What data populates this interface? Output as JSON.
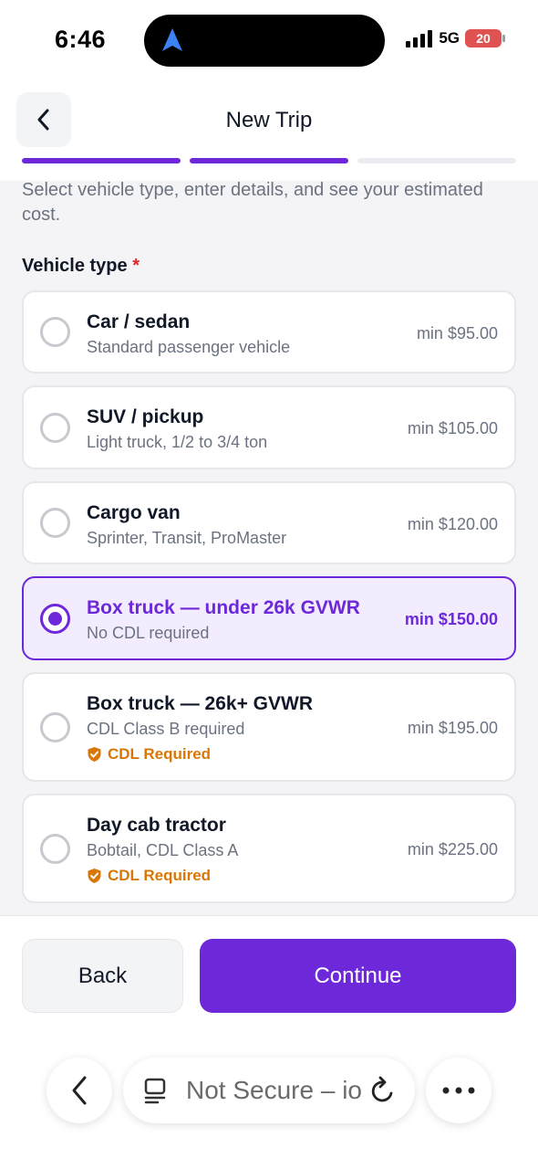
{
  "status_bar": {
    "time": "6:46",
    "network": "5G",
    "battery": "20"
  },
  "header": {
    "title": "New Trip"
  },
  "progress": {
    "steps": 3,
    "current": 2
  },
  "intro": {
    "text": "Select vehicle type, enter details, and see your estimated cost."
  },
  "vehicle_section": {
    "label": "Vehicle type",
    "required_mark": "*"
  },
  "vehicle_options": [
    {
      "title": "Car / sedan",
      "subtitle": "Standard passenger vehicle",
      "price": "min $95.00",
      "selected": false,
      "badge": ""
    },
    {
      "title": "SUV / pickup",
      "subtitle": "Light truck, 1/2 to 3/4 ton",
      "price": "min $105.00",
      "selected": false,
      "badge": ""
    },
    {
      "title": "Cargo van",
      "subtitle": "Sprinter, Transit, ProMaster",
      "price": "min $120.00",
      "selected": false,
      "badge": ""
    },
    {
      "title": "Box truck — under 26k GVWR",
      "subtitle": "No CDL required",
      "price": "min $150.00",
      "selected": true,
      "badge": ""
    },
    {
      "title": "Box truck — 26k+ GVWR",
      "subtitle": "CDL Class B required",
      "price": "min $195.00",
      "selected": false,
      "badge": "CDL Required"
    },
    {
      "title": "Day cab tractor",
      "subtitle": "Bobtail, CDL Class A",
      "price": "min $225.00",
      "selected": false,
      "badge": "CDL Required"
    }
  ],
  "footer": {
    "back_label": "Back",
    "continue_label": "Continue"
  },
  "browser": {
    "url_text": "Not Secure – io"
  },
  "colors": {
    "accent": "#6d28d9",
    "badge": "#d97706",
    "required": "#dc2626"
  }
}
